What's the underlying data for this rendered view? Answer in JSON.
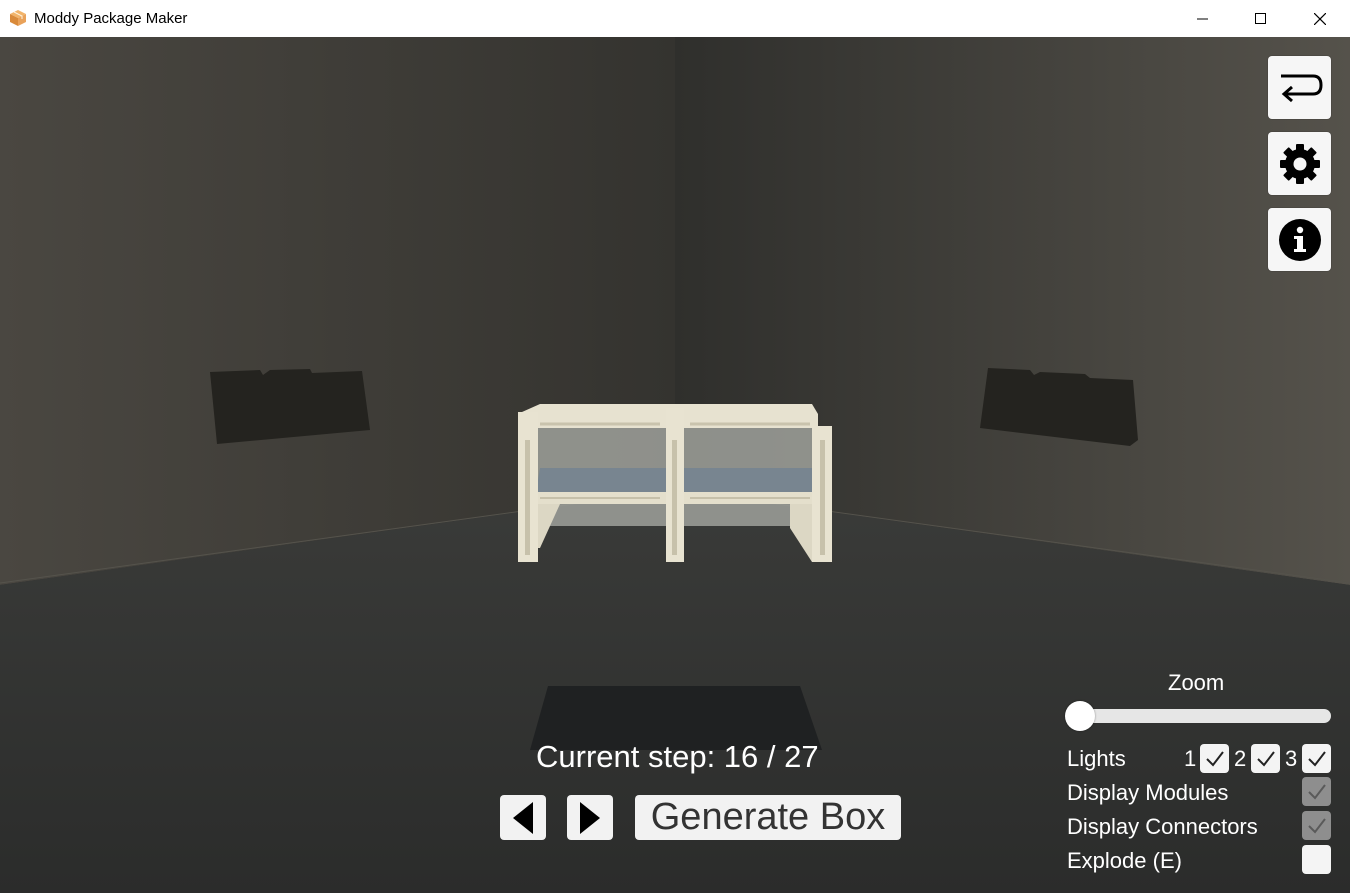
{
  "window": {
    "title": "Moddy Package Maker",
    "icon": "package-box-icon",
    "controls": [
      "minimize-icon",
      "maximize-icon",
      "close-icon"
    ]
  },
  "tools": [
    {
      "name": "undo",
      "icon": "return-arrow-icon"
    },
    {
      "name": "settings",
      "icon": "gear-icon"
    },
    {
      "name": "info",
      "icon": "info-icon"
    }
  ],
  "step": {
    "text": "Current step: 16 / 27",
    "current": 16,
    "total": 27
  },
  "navigation": {
    "prev_icon": "triangle-left-icon",
    "next_icon": "triangle-right-icon",
    "generate_label": "Generate Box"
  },
  "zoom": {
    "label": "Zoom",
    "value": 0
  },
  "lights": {
    "label": "Lights",
    "items": [
      {
        "number": "1",
        "checked": true
      },
      {
        "number": "2",
        "checked": true
      },
      {
        "number": "3",
        "checked": true
      }
    ]
  },
  "options": [
    {
      "label": "Display Modules",
      "checked": true,
      "enabled": false
    },
    {
      "label": "Display Connectors",
      "checked": true,
      "enabled": false
    },
    {
      "label": "Explode (E)",
      "checked": false,
      "enabled": true
    }
  ],
  "colors": {
    "titlebar": "#ffffff",
    "button_bg": "#f6f6f6",
    "text_on_scene": "#ffffff",
    "module_color": "#e6e1cf",
    "shelf_color": "#7a8790"
  }
}
